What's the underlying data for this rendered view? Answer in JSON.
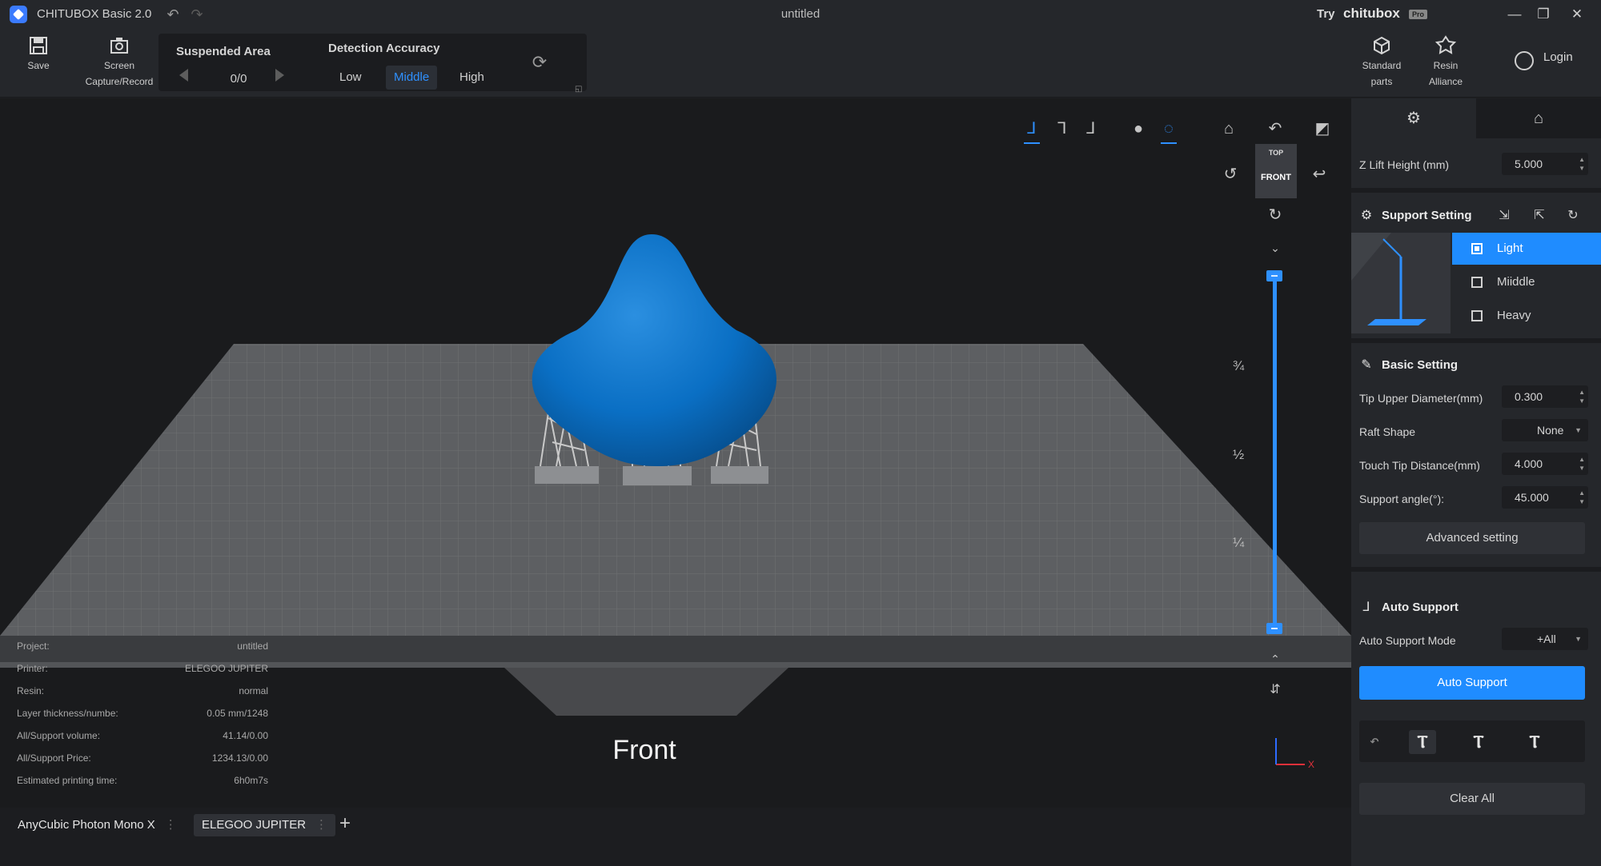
{
  "titlebar": {
    "app_name": "CHITUBOX Basic 2.0",
    "doc_title": "untitled",
    "try_label": "Try",
    "brand": "chitubox",
    "brand_badge": "Pro"
  },
  "toolbar": {
    "save_label": "Save",
    "screen_label_1": "Screen",
    "screen_label_2": "Capture/Record",
    "suspended_title": "Suspended Area",
    "suspended_count": "0/0",
    "detection_title": "Detection Accuracy",
    "detection_options": [
      "Low",
      "Middle",
      "High"
    ],
    "detection_selected": "Middle",
    "standard_label_1": "Standard",
    "standard_label_2": "parts",
    "resin_label_1": "Resin",
    "resin_label_2": "Alliance",
    "login_label": "Login"
  },
  "viewport": {
    "cube_top": "TOP",
    "cube_front": "FRONT",
    "slider_marks": [
      "¾",
      "½",
      "¼"
    ],
    "view_label": "Front",
    "info": [
      {
        "label": "Project:",
        "value": "untitled"
      },
      {
        "label": "Printer:",
        "value": "ELEGOO JUPITER"
      },
      {
        "label": "Resin:",
        "value": "normal"
      },
      {
        "label": "Layer thickness/numbe:",
        "value": "0.05 mm/1248"
      },
      {
        "label": "All/Support volume:",
        "value": "41.14/0.00"
      },
      {
        "label": "All/Support Price:",
        "value": "1234.13/0.00"
      },
      {
        "label": "Estimated printing time:",
        "value": "6h0m7s"
      }
    ],
    "axis_x": "X"
  },
  "printer_tabs": [
    {
      "label": "AnyCubic Photon Mono X"
    },
    {
      "label": "ELEGOO JUPITER"
    }
  ],
  "right_panel": {
    "z_lift_label": "Z Lift Height (mm)",
    "z_lift_value": "5.000",
    "support_setting_title": "Support Setting",
    "support_options": [
      "Light",
      "Miiddle",
      "Heavy"
    ],
    "support_selected": "Light",
    "basic_setting_title": "Basic Setting",
    "tip_upper_label": "Tip Upper Diameter(mm)",
    "tip_upper_value": "0.300",
    "raft_shape_label": "Raft Shape",
    "raft_shape_value": "None",
    "touch_tip_label": "Touch Tip Distance(mm)",
    "touch_tip_value": "4.000",
    "support_angle_label": "Support angle(°):",
    "support_angle_value": "45.000",
    "advanced_label": "Advanced setting",
    "auto_support_title": "Auto Support",
    "auto_mode_label": "Auto Support Mode",
    "auto_mode_value": "+All",
    "auto_support_button": "Auto Support",
    "clear_all_button": "Clear All"
  },
  "colors": {
    "accent": "#1f8cff",
    "model": "#0a6fc4",
    "panel": "#25272b"
  }
}
